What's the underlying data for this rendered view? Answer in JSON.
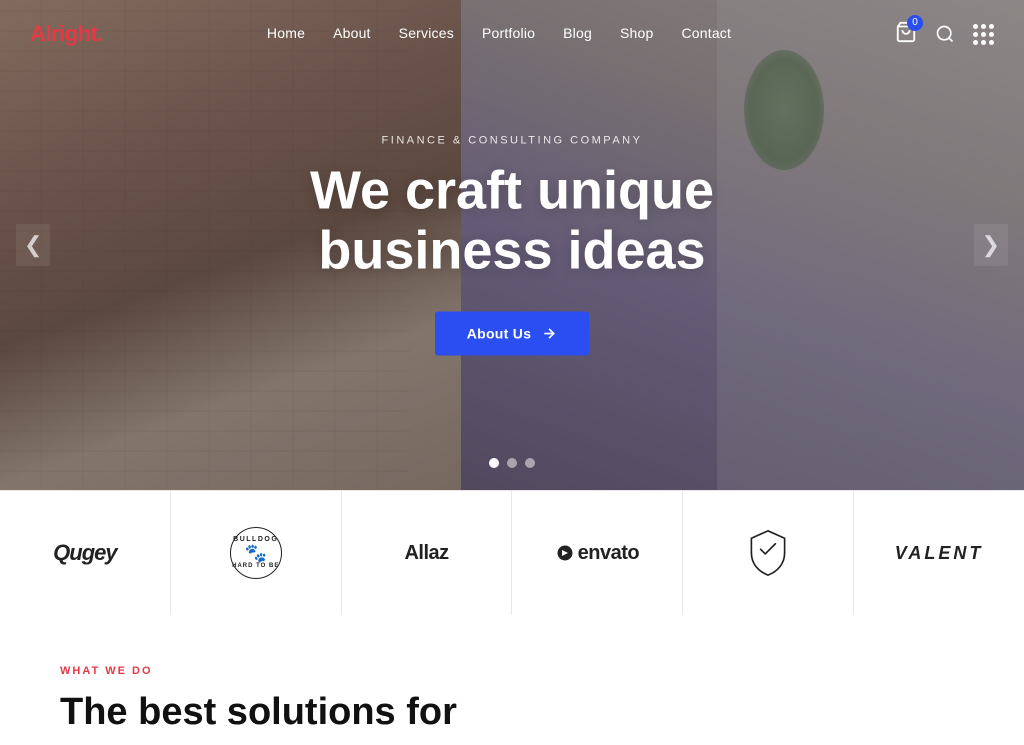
{
  "logo": {
    "text": "Alright",
    "dot": "."
  },
  "nav": {
    "links": [
      {
        "label": "Home",
        "href": "#"
      },
      {
        "label": "About",
        "href": "#"
      },
      {
        "label": "Services",
        "href": "#"
      },
      {
        "label": "Portfolio",
        "href": "#"
      },
      {
        "label": "Blog",
        "href": "#"
      },
      {
        "label": "Shop",
        "href": "#"
      },
      {
        "label": "Contact",
        "href": "#"
      }
    ],
    "cart_count": "0"
  },
  "hero": {
    "subtitle": "Finance & Consulting Company",
    "title_line1": "We craft unique",
    "title_line2": "business ideas",
    "cta_label": "About Us",
    "arrow_left": "❮",
    "arrow_right": "❯",
    "dots": [
      true,
      false,
      false
    ]
  },
  "partners": [
    {
      "name": "Qugey",
      "type": "text"
    },
    {
      "name": "BULLDOG",
      "type": "bulldog"
    },
    {
      "name": "Allaz",
      "type": "text"
    },
    {
      "name": "envato",
      "type": "text-dot"
    },
    {
      "name": "shield",
      "type": "shield"
    },
    {
      "name": "VALENT",
      "type": "text"
    }
  ],
  "what_we_do": {
    "tag": "What We Do",
    "title_line1": "The best solutions for"
  },
  "colors": {
    "accent": "#e63946",
    "primary": "#2b4ef0"
  }
}
